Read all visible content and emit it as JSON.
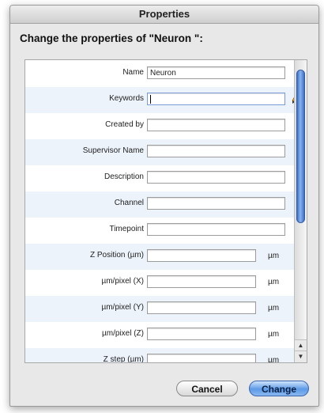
{
  "window": {
    "title": "Properties"
  },
  "heading": "Change the properties of \"Neuron \":",
  "fields": [
    {
      "label": "Name",
      "value": "Neuron",
      "unit": ""
    },
    {
      "label": "Keywords",
      "value": "",
      "unit": ""
    },
    {
      "label": "Created by",
      "value": "",
      "unit": ""
    },
    {
      "label": "Supervisor Name",
      "value": "",
      "unit": ""
    },
    {
      "label": "Description",
      "value": "",
      "unit": ""
    },
    {
      "label": "Channel",
      "value": "",
      "unit": ""
    },
    {
      "label": "Timepoint",
      "value": "",
      "unit": ""
    },
    {
      "label": "Z Position (µm)",
      "value": "",
      "unit": "µm"
    },
    {
      "label": "µm/pixel (X)",
      "value": "",
      "unit": "µm"
    },
    {
      "label": "µm/pixel (Y)",
      "value": "",
      "unit": "µm"
    },
    {
      "label": "µm/pixel (Z)",
      "value": "",
      "unit": "µm"
    },
    {
      "label": "Z step (µm)",
      "value": "",
      "unit": "µm"
    }
  ],
  "icons": {
    "edit": "pencil-icon",
    "scroll_up": "arrow-up-icon",
    "scroll_down": "arrow-down-icon"
  },
  "colors": {
    "accent": "#5c9ae6",
    "stripe": "#edf3fb"
  },
  "buttons": {
    "cancel_label": "Cancel",
    "change_label": "Change"
  }
}
